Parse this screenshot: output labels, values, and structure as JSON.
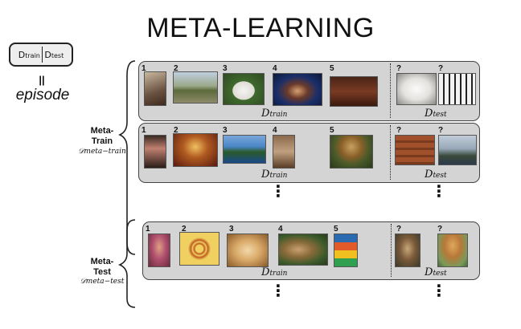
{
  "title": "META-LEARNING",
  "episode_box": {
    "d_symbol": "D",
    "train_sub": "train",
    "test_sub": "test"
  },
  "equals_symbol": "||",
  "episode_label": "episode",
  "meta_train": {
    "label_line1": "Meta-",
    "label_line2": "Train",
    "symbol": "𝒟meta−train"
  },
  "meta_test": {
    "label_line1": "Meta-",
    "label_line2": "Test",
    "symbol": "𝒟meta−test"
  },
  "d_train_label": {
    "d": "D",
    "sub": "train"
  },
  "d_test_label": {
    "d": "D",
    "sub": "test"
  },
  "ellipsis": "⋮",
  "rows": [
    {
      "train_numbers": [
        "1",
        "2",
        "3",
        "4",
        "5"
      ],
      "test_marks": [
        "?",
        "?"
      ],
      "images": [
        "bird",
        "tank",
        "white dog",
        "singer",
        "piano",
        "white dog",
        "piano keys"
      ]
    },
    {
      "train_numbers": [
        "1",
        "2",
        "3",
        "4",
        "5"
      ],
      "test_marks": [
        "?",
        "?"
      ],
      "images": [
        "gymnast",
        "carousel",
        "coastline",
        "barrel",
        "mushroom",
        "barrels",
        "cliffs"
      ]
    },
    {
      "train_numbers": [
        "1",
        "2",
        "3",
        "4",
        "5"
      ],
      "test_marks": [
        "?",
        "?"
      ],
      "images": [
        "girl",
        "pretzel",
        "retriever",
        "lion",
        "bowls",
        "lion",
        "bowl"
      ]
    }
  ],
  "colors": {
    "panel": "#d4d4d4",
    "border": "#444444"
  }
}
